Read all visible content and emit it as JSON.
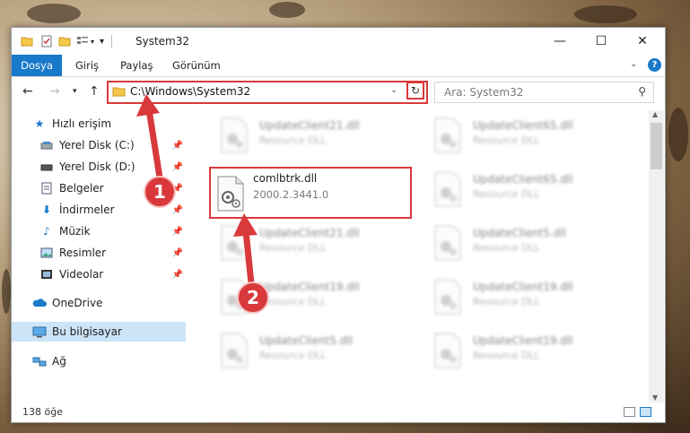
{
  "window": {
    "title": "System32",
    "controls": {
      "minimize": "—",
      "maximize": "☐",
      "close": "✕"
    }
  },
  "ribbon": {
    "tabs": [
      "Dosya",
      "Giriş",
      "Paylaş",
      "Görünüm"
    ]
  },
  "address": {
    "path": "C:\\Windows\\System32",
    "search_placeholder": "Ara: System32"
  },
  "nav": {
    "items": [
      {
        "label": "Hızlı erişim",
        "icon": "star-icon",
        "pinned": false
      },
      {
        "label": "Yerel Disk (C:)",
        "icon": "drive-icon",
        "pinned": true
      },
      {
        "label": "Yerel Disk (D:)",
        "icon": "drive-icon",
        "pinned": true
      },
      {
        "label": "Belgeler",
        "icon": "documents-icon",
        "pinned": true
      },
      {
        "label": "İndirmeler",
        "icon": "download-icon",
        "pinned": true
      },
      {
        "label": "Müzik",
        "icon": "music-icon",
        "pinned": true
      },
      {
        "label": "Resimler",
        "icon": "pictures-icon",
        "pinned": true
      },
      {
        "label": "Videolar",
        "icon": "videos-icon",
        "pinned": true
      },
      {
        "label": "OneDrive",
        "icon": "cloud-icon",
        "pinned": false
      },
      {
        "label": "Bu bilgisayar",
        "icon": "computer-icon",
        "pinned": false,
        "selected": true
      },
      {
        "label": "Ağ",
        "icon": "network-icon",
        "pinned": false
      }
    ]
  },
  "files": {
    "highlighted": {
      "name": "comlbtrk.dll",
      "version": "2000.2.3441.0"
    },
    "left_column": [
      {
        "name": "UpdateClient21.dll",
        "type": "Resource DLL"
      },
      {
        "name": "UpdateClient21.dll",
        "type": "Resource DLL"
      },
      {
        "name": "UpdateClient19.dll",
        "type": "Resource DLL"
      },
      {
        "name": "UpdateClient5.dll",
        "type": "Resource DLL"
      }
    ],
    "right_column": [
      {
        "name": "UpdateClient65.dll",
        "type": "Resource DLL"
      },
      {
        "name": "UpdateClient65.dll",
        "type": "Resource DLL"
      },
      {
        "name": "UpdateClient5.dll",
        "type": "Resource DLL"
      },
      {
        "name": "UpdateClient19.dll",
        "type": "Resource DLL"
      },
      {
        "name": "UpdateClient19.dll",
        "type": "Resource DLL"
      }
    ]
  },
  "status": {
    "count": "138 öğe"
  },
  "callouts": [
    "1",
    "2"
  ],
  "colors": {
    "accent": "#1979ca",
    "highlight": "#d9393b",
    "selection": "#cce4f7"
  }
}
